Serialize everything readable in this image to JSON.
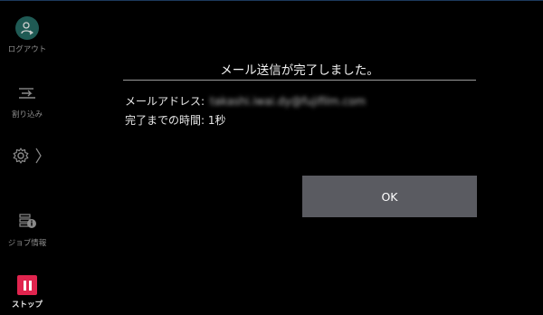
{
  "sidebar": {
    "logout_label": "ログアウト",
    "interrupt_label": "割り込み",
    "job_info_label": "ジョブ情報",
    "stop_label": "ストップ"
  },
  "dialog": {
    "title": "メール送信が完了しました。",
    "email_label": "メールアドレス:",
    "email_value": "takashi.iwai.dy@fujifilm.com",
    "time_label": "完了までの時間:",
    "time_value": "1秒",
    "ok_label": "OK"
  },
  "colors": {
    "background": "#000000",
    "ok_button": "#5a5b61",
    "stop_accent": "#e0244e",
    "logout_accent": "#1f5a54"
  }
}
